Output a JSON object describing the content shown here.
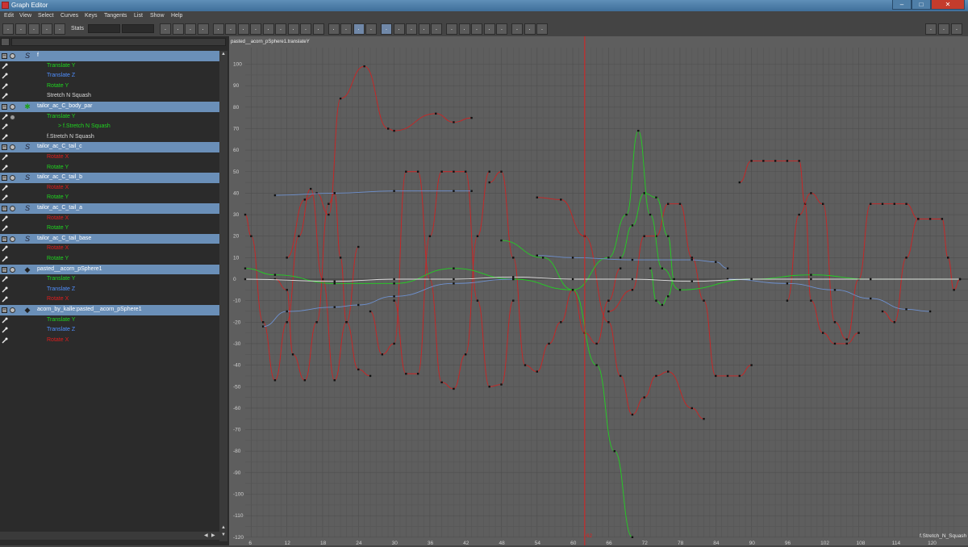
{
  "window": {
    "title": "Graph Editor",
    "buttons": [
      "–",
      "□",
      "✕"
    ]
  },
  "menu": [
    "Edit",
    "View",
    "Select",
    "Curves",
    "Keys",
    "Tangents",
    "List",
    "Show",
    "Help"
  ],
  "toolbar": {
    "stats_label": "Stats",
    "icons": [
      "move-key-icon",
      "insert-key-icon",
      "add-key-icon",
      "lattice-deform-icon",
      "region-tool-icon",
      "key-stats-icon",
      "frame-all-icon",
      "frame-selection-icon",
      "frame-playback-icon",
      "auto-tangent-icon",
      "spline-tangent-icon",
      "clamped-tangent-icon",
      "linear-tangent-icon",
      "flat-tangent-icon",
      "step-tangent-icon",
      "plateau-tangent-icon",
      "break-tangent-icon",
      "unify-tangent-icon",
      "free-weight-icon",
      "lock-weight-icon",
      "buffer-curve-icon",
      "swap-buffer-icon",
      "snap-icon",
      "time-snap-icon",
      "value-snap-icon",
      "normalize-icon",
      "denormalize-icon",
      "pre-infinity-icon",
      "post-infinity-icon",
      "cycle-icon",
      "cycle-offset-icon",
      "oscillate-icon",
      "dope-sheet-icon",
      "trax-icon",
      "camera-sequencer-icon",
      "single-view-icon",
      "stacked-view-icon",
      "normalized-view-icon"
    ]
  },
  "outliner": [
    {
      "type": "node",
      "label": "f",
      "icon": "curve-icon"
    },
    {
      "type": "attr",
      "label": "Translate Y",
      "color": "#1fd61f"
    },
    {
      "type": "attr",
      "label": "Translate Z",
      "color": "#4f8fff"
    },
    {
      "type": "attr",
      "label": "Rotate Y",
      "color": "#1fd61f"
    },
    {
      "type": "attr",
      "label": "Stretch N Squash",
      "color": "#d8d8d8"
    },
    {
      "type": "node",
      "label": "tailor_ac_C_body_par",
      "icon": "joint-star-icon"
    },
    {
      "type": "attr",
      "label": "Translate Y",
      "color": "#1fd61f"
    },
    {
      "type": "attr",
      "label": "> f.Stretch N Squash",
      "color": "#1fd61f",
      "indent": 14
    },
    {
      "type": "attr",
      "label": "f.Stretch N Squash",
      "color": "#d8d8d8"
    },
    {
      "type": "node",
      "label": "tailor_ac_C_tail_c",
      "icon": "curve-icon"
    },
    {
      "type": "attr",
      "label": "Rotate X",
      "color": "#e01c1c"
    },
    {
      "type": "attr",
      "label": "Rotate Y",
      "color": "#1fd61f"
    },
    {
      "type": "node",
      "label": "tailor_ac_C_tail_b",
      "icon": "curve-icon"
    },
    {
      "type": "attr",
      "label": "Rotate X",
      "color": "#e01c1c"
    },
    {
      "type": "attr",
      "label": "Rotate Y",
      "color": "#1fd61f"
    },
    {
      "type": "node",
      "label": "tailor_ac_C_tail_a",
      "icon": "curve-icon"
    },
    {
      "type": "attr",
      "label": "Rotate X",
      "color": "#e01c1c"
    },
    {
      "type": "attr",
      "label": "Rotate Y",
      "color": "#1fd61f"
    },
    {
      "type": "node",
      "label": "tailor_ac_C_tail_base",
      "icon": "curve-icon"
    },
    {
      "type": "attr",
      "label": "Rotate X",
      "color": "#e01c1c"
    },
    {
      "type": "attr",
      "label": "Rotate Y",
      "color": "#1fd61f"
    },
    {
      "type": "node",
      "label": "pasted__acorn_pSphere1",
      "icon": "mesh-icon"
    },
    {
      "type": "attr",
      "label": "Translate Y",
      "color": "#1fd61f"
    },
    {
      "type": "attr",
      "label": "Translate Z",
      "color": "#4f8fff"
    },
    {
      "type": "attr",
      "label": "Rotate X",
      "color": "#e01c1c"
    },
    {
      "type": "node",
      "label": "acorn_by_kalle:pasted__acorn_pSphere1",
      "icon": "mesh-icon"
    },
    {
      "type": "attr",
      "label": "Translate Y",
      "color": "#1fd61f"
    },
    {
      "type": "attr",
      "label": "Translate Z",
      "color": "#4f8fff"
    },
    {
      "type": "attr",
      "label": "Rotate X",
      "color": "#e01c1c"
    }
  ],
  "graph": {
    "corner_label": "pasted__acorn_pSphere1.translateY",
    "curve_label": "f.Stretch_N_Squash",
    "current_frame": 62,
    "current_frame_label": "62",
    "x_ticks": [
      "6",
      "12",
      "18",
      "24",
      "30",
      "36",
      "42",
      "48",
      "54",
      "60",
      "66",
      "72",
      "78",
      "84",
      "90",
      "96",
      "102",
      "108",
      "114",
      "120"
    ],
    "y_ticks": [
      "100",
      "90",
      "80",
      "70",
      "60",
      "50",
      "40",
      "30",
      "20",
      "10",
      "0",
      "-10",
      "-20",
      "-30",
      "-40",
      "-50",
      "-60",
      "-70",
      "-80",
      "-90",
      "-100",
      "-110",
      "-120"
    ],
    "colors": {
      "red": "#d42020",
      "green": "#1fd61f",
      "blue": "#6f94d6",
      "white": "#e8e8e8",
      "time": "#e02020"
    }
  },
  "chart_data": {
    "type": "line",
    "title": "",
    "xlabel": "",
    "ylabel": "",
    "xlim": [
      5,
      125
    ],
    "ylim": [
      -120,
      105
    ],
    "series": [
      {
        "color": "red",
        "points": [
          [
            12,
            10
          ],
          [
            15,
            37
          ],
          [
            17,
            40
          ],
          [
            19,
            30
          ],
          [
            21,
            84
          ],
          [
            25,
            99
          ],
          [
            29,
            70
          ],
          [
            30,
            69
          ],
          [
            37,
            77
          ],
          [
            40,
            73
          ],
          [
            43,
            75
          ]
        ]
      },
      {
        "color": "red",
        "points": [
          [
            5,
            30
          ],
          [
            6,
            20
          ],
          [
            8,
            -20
          ],
          [
            10,
            -47
          ],
          [
            12,
            -20
          ],
          [
            14,
            20
          ],
          [
            16,
            42
          ],
          [
            18,
            0
          ],
          [
            20,
            -47
          ],
          [
            22,
            -20
          ],
          [
            24,
            15
          ]
        ]
      },
      {
        "color": "red",
        "points": [
          [
            10,
            0
          ],
          [
            12,
            -5
          ],
          [
            13,
            -35
          ],
          [
            15,
            -47
          ],
          [
            17,
            -20
          ],
          [
            19,
            35
          ],
          [
            20,
            40
          ],
          [
            21,
            10
          ],
          [
            22,
            -20
          ],
          [
            24,
            -42
          ],
          [
            26,
            -45
          ]
        ]
      },
      {
        "color": "red",
        "points": [
          [
            26,
            -15
          ],
          [
            28,
            -35
          ],
          [
            30,
            -30
          ],
          [
            32,
            50
          ],
          [
            34,
            50
          ],
          [
            36,
            0
          ],
          [
            38,
            -48
          ],
          [
            40,
            -51
          ],
          [
            42,
            -35
          ],
          [
            44,
            20
          ],
          [
            46,
            50
          ]
        ]
      },
      {
        "color": "red",
        "points": [
          [
            30,
            -10
          ],
          [
            32,
            -44
          ],
          [
            34,
            -44
          ],
          [
            36,
            20
          ],
          [
            38,
            50
          ],
          [
            40,
            50
          ],
          [
            42,
            50
          ],
          [
            44,
            -10
          ],
          [
            46,
            -50
          ],
          [
            48,
            -49
          ],
          [
            50,
            -10
          ]
        ]
      },
      {
        "color": "red",
        "points": [
          [
            46,
            45
          ],
          [
            48,
            50
          ],
          [
            50,
            10
          ],
          [
            52,
            -40
          ],
          [
            54,
            -43
          ],
          [
            56,
            -30
          ],
          [
            58,
            -20
          ],
          [
            60,
            -5
          ],
          [
            62,
            -25
          ],
          [
            64,
            -30
          ],
          [
            66,
            -10
          ],
          [
            68,
            5
          ]
        ]
      },
      {
        "color": "red",
        "points": [
          [
            54,
            38
          ],
          [
            58,
            37
          ],
          [
            62,
            20
          ],
          [
            66,
            -20
          ],
          [
            68,
            -45
          ],
          [
            70,
            -63
          ],
          [
            72,
            -55
          ],
          [
            74,
            -45
          ],
          [
            76,
            -43
          ],
          [
            80,
            -60
          ],
          [
            82,
            -65
          ]
        ]
      },
      {
        "color": "red",
        "points": [
          [
            66,
            -15
          ],
          [
            70,
            -5
          ],
          [
            72,
            20
          ],
          [
            74,
            20
          ],
          [
            76,
            35
          ],
          [
            78,
            35
          ],
          [
            80,
            10
          ],
          [
            82,
            -10
          ],
          [
            84,
            -45
          ],
          [
            86,
            -45
          ],
          [
            88,
            -45
          ],
          [
            90,
            -40
          ]
        ]
      },
      {
        "color": "red",
        "points": [
          [
            88,
            45
          ],
          [
            90,
            55
          ],
          [
            92,
            55
          ],
          [
            94,
            55
          ],
          [
            96,
            55
          ],
          [
            98,
            55
          ],
          [
            99,
            35
          ],
          [
            100,
            -10
          ],
          [
            102,
            -25
          ],
          [
            104,
            -30
          ],
          [
            106,
            -30
          ],
          [
            108,
            -25
          ]
        ]
      },
      {
        "color": "red",
        "points": [
          [
            96,
            -10
          ],
          [
            98,
            30
          ],
          [
            100,
            40
          ],
          [
            102,
            35
          ],
          [
            104,
            -20
          ],
          [
            106,
            -28
          ],
          [
            108,
            0
          ],
          [
            110,
            35
          ],
          [
            112,
            35
          ],
          [
            114,
            35
          ],
          [
            116,
            35
          ],
          [
            118,
            28
          ]
        ]
      },
      {
        "color": "red",
        "points": [
          [
            112,
            -15
          ],
          [
            114,
            -20
          ],
          [
            116,
            10
          ],
          [
            118,
            28
          ],
          [
            120,
            28
          ],
          [
            122,
            28
          ],
          [
            123,
            10
          ],
          [
            124,
            -5
          ],
          [
            125,
            0
          ]
        ]
      },
      {
        "color": "green",
        "points": [
          [
            5,
            5
          ],
          [
            10,
            2
          ],
          [
            20,
            -2
          ],
          [
            30,
            -2
          ],
          [
            40,
            5
          ],
          [
            50,
            0
          ],
          [
            60,
            -5
          ],
          [
            66,
            10
          ],
          [
            69,
            30
          ],
          [
            71,
            69
          ],
          [
            73,
            30
          ],
          [
            75,
            5
          ],
          [
            78,
            -5
          ],
          [
            90,
            0
          ],
          [
            100,
            2
          ],
          [
            110,
            0
          ],
          [
            125,
            0
          ]
        ]
      },
      {
        "color": "green",
        "points": [
          [
            48,
            18
          ],
          [
            55,
            10
          ],
          [
            60,
            -5
          ],
          [
            64,
            -40
          ],
          [
            67,
            -80
          ],
          [
            70,
            -120
          ]
        ]
      },
      {
        "color": "green",
        "points": [
          [
            68,
            10
          ],
          [
            70,
            25
          ],
          [
            72,
            40
          ],
          [
            74,
            38
          ],
          [
            76,
            20
          ],
          [
            77,
            0
          ],
          [
            76,
            -8
          ],
          [
            75,
            -12
          ],
          [
            74,
            -10
          ],
          [
            73,
            5
          ]
        ]
      },
      {
        "color": "blue",
        "points": [
          [
            10,
            39
          ],
          [
            20,
            40
          ],
          [
            30,
            41
          ],
          [
            40,
            41
          ],
          [
            43,
            41
          ]
        ]
      },
      {
        "color": "blue",
        "points": [
          [
            8,
            -22
          ],
          [
            12,
            -15
          ],
          [
            20,
            -13
          ],
          [
            24,
            -12
          ],
          [
            30,
            -8
          ],
          [
            40,
            -2
          ],
          [
            50,
            0
          ]
        ]
      },
      {
        "color": "blue",
        "points": [
          [
            54,
            11
          ],
          [
            60,
            10
          ],
          [
            70,
            9
          ],
          [
            80,
            9
          ],
          [
            84,
            8
          ],
          [
            86,
            5
          ]
        ]
      },
      {
        "color": "blue",
        "points": [
          [
            86,
            0
          ],
          [
            96,
            -2
          ],
          [
            104,
            -5
          ],
          [
            110,
            -9
          ],
          [
            116,
            -14
          ],
          [
            120,
            -15
          ]
        ]
      },
      {
        "color": "white",
        "points": [
          [
            5,
            0
          ],
          [
            20,
            -1
          ],
          [
            30,
            0
          ],
          [
            40,
            0
          ],
          [
            50,
            1
          ],
          [
            60,
            0
          ],
          [
            70,
            0
          ],
          [
            80,
            -1
          ],
          [
            90,
            0
          ],
          [
            100,
            0
          ],
          [
            110,
            0
          ],
          [
            125,
            0
          ]
        ]
      }
    ]
  }
}
